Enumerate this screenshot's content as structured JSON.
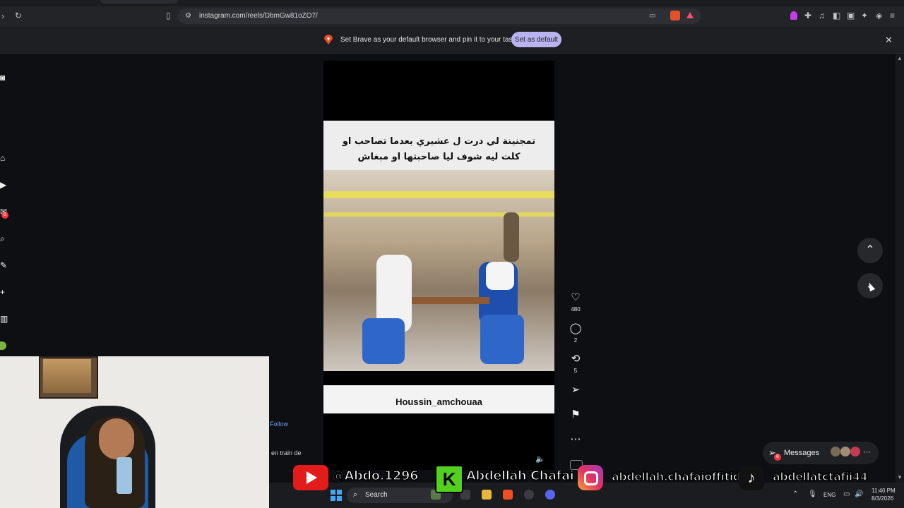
{
  "browser": {
    "url": "instagram.com/reels/DbmGw81oZO7/",
    "infobar_text": "Set Brave as your default browser and pin it to your taskbar",
    "set_default_label": "Set as default",
    "close_glyph": "✕"
  },
  "sidebar": {
    "badge_count": "8",
    "icons": [
      "instagram-icon",
      "home-icon",
      "reels-icon",
      "messages-icon",
      "search-icon",
      "explore-icon",
      "create-icon",
      "dashboard-icon",
      "profile-icon"
    ]
  },
  "reel": {
    "caption_line1": "تمجنينة لي درت ل عشيري بعدما تصاحب او",
    "caption_line2": "كلت ليه شوف ليا صاحبتها او مبغاش",
    "watermark": "Houssin_amchouaa",
    "likes": "480",
    "comments": "2",
    "reposts": "5"
  },
  "page_partials": {
    "follow_text": "Follow",
    "status_text": "en train de"
  },
  "messages": {
    "label": "Messages",
    "badge": "8"
  },
  "overlay": {
    "youtube_handle": "@Abdo.1296",
    "kick_letter": "K",
    "kick_name": "Abdellah Chafai",
    "instagram_handle": "abdellah.chafaioffitid",
    "tiktok_handle": "abdellatctafii44"
  },
  "taskbar": {
    "search_label": "Search",
    "language": "ENG",
    "time": "11:40 PM",
    "date": "8/3/2026"
  },
  "colors": {
    "brand_accent": "#b9b4f0",
    "notification_red": "#ff3040",
    "youtube_red": "#e21b1b",
    "kick_green": "#52d21f"
  }
}
